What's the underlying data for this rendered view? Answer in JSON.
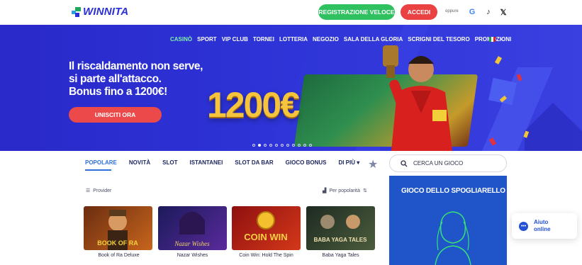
{
  "brand": {
    "name": "WINNITA"
  },
  "header": {
    "register_label": "REGISTRAZIONE VELOCE",
    "login_label": "ACCEDI",
    "or_label": "oppure",
    "social": [
      {
        "icon": "google-icon",
        "glyph": "G"
      },
      {
        "icon": "tiktok-icon",
        "glyph": "♪"
      },
      {
        "icon": "x-icon",
        "glyph": "𝕏"
      }
    ]
  },
  "nav": {
    "items": [
      "CASINÒ",
      "SPORT",
      "VIP CLUB",
      "TORNEI",
      "LOTTERIA",
      "NEGOZIO",
      "SALA DELLA GLORIA",
      "SCRIGNI DEL TESORO",
      "PROMOZIONI"
    ],
    "active": "CASINÒ",
    "language_flag": "flag-it-icon"
  },
  "hero": {
    "line1": "Il riscaldamento non serve,",
    "line2": "si parte all'attacco.",
    "line3": "Bonus fino a 1200€!",
    "cta_label": "UNISCITI ORA",
    "amount": "1200€",
    "slides_total": 11,
    "slide_active": 1
  },
  "categories": {
    "items": [
      "POPOLARE",
      "NOVITÀ",
      "SLOT",
      "ISTANTANEI",
      "SLOT DA BAR",
      "GIOCO BONUS",
      "DI PIÙ"
    ],
    "active": "POPOLARE"
  },
  "search": {
    "placeholder": "CERCA UN GIOCO"
  },
  "filters": {
    "provider_label": "Provider",
    "sort_label": "Per popolarità"
  },
  "games": [
    {
      "title": "Book of Ra Deluxe",
      "art": "BOOK OF RA",
      "colors": [
        "#6b2d10",
        "#c8651d"
      ]
    },
    {
      "title": "Nazar Wishes",
      "art": "Nazar Wishes",
      "colors": [
        "#1b1a5a",
        "#5a2a9c"
      ]
    },
    {
      "title": "Coin Win: Hold The Spin",
      "art": "COIN WIN",
      "colors": [
        "#8e1010",
        "#d4381a"
      ]
    },
    {
      "title": "Baba Yaga Tales",
      "art": "BABA YAGA TALES",
      "colors": [
        "#1e2a22",
        "#4b5d3c"
      ]
    }
  ],
  "side_promo": {
    "title": "GIOCO DELLO SPOGLIARELLO"
  },
  "chat": {
    "line1": "Aiuto",
    "line2": "online"
  },
  "colors": {
    "brand_blue": "#2a2fd6",
    "register_green": "#2fc160",
    "login_red": "#ea4242",
    "active_nav_green": "#7ef0a8"
  }
}
